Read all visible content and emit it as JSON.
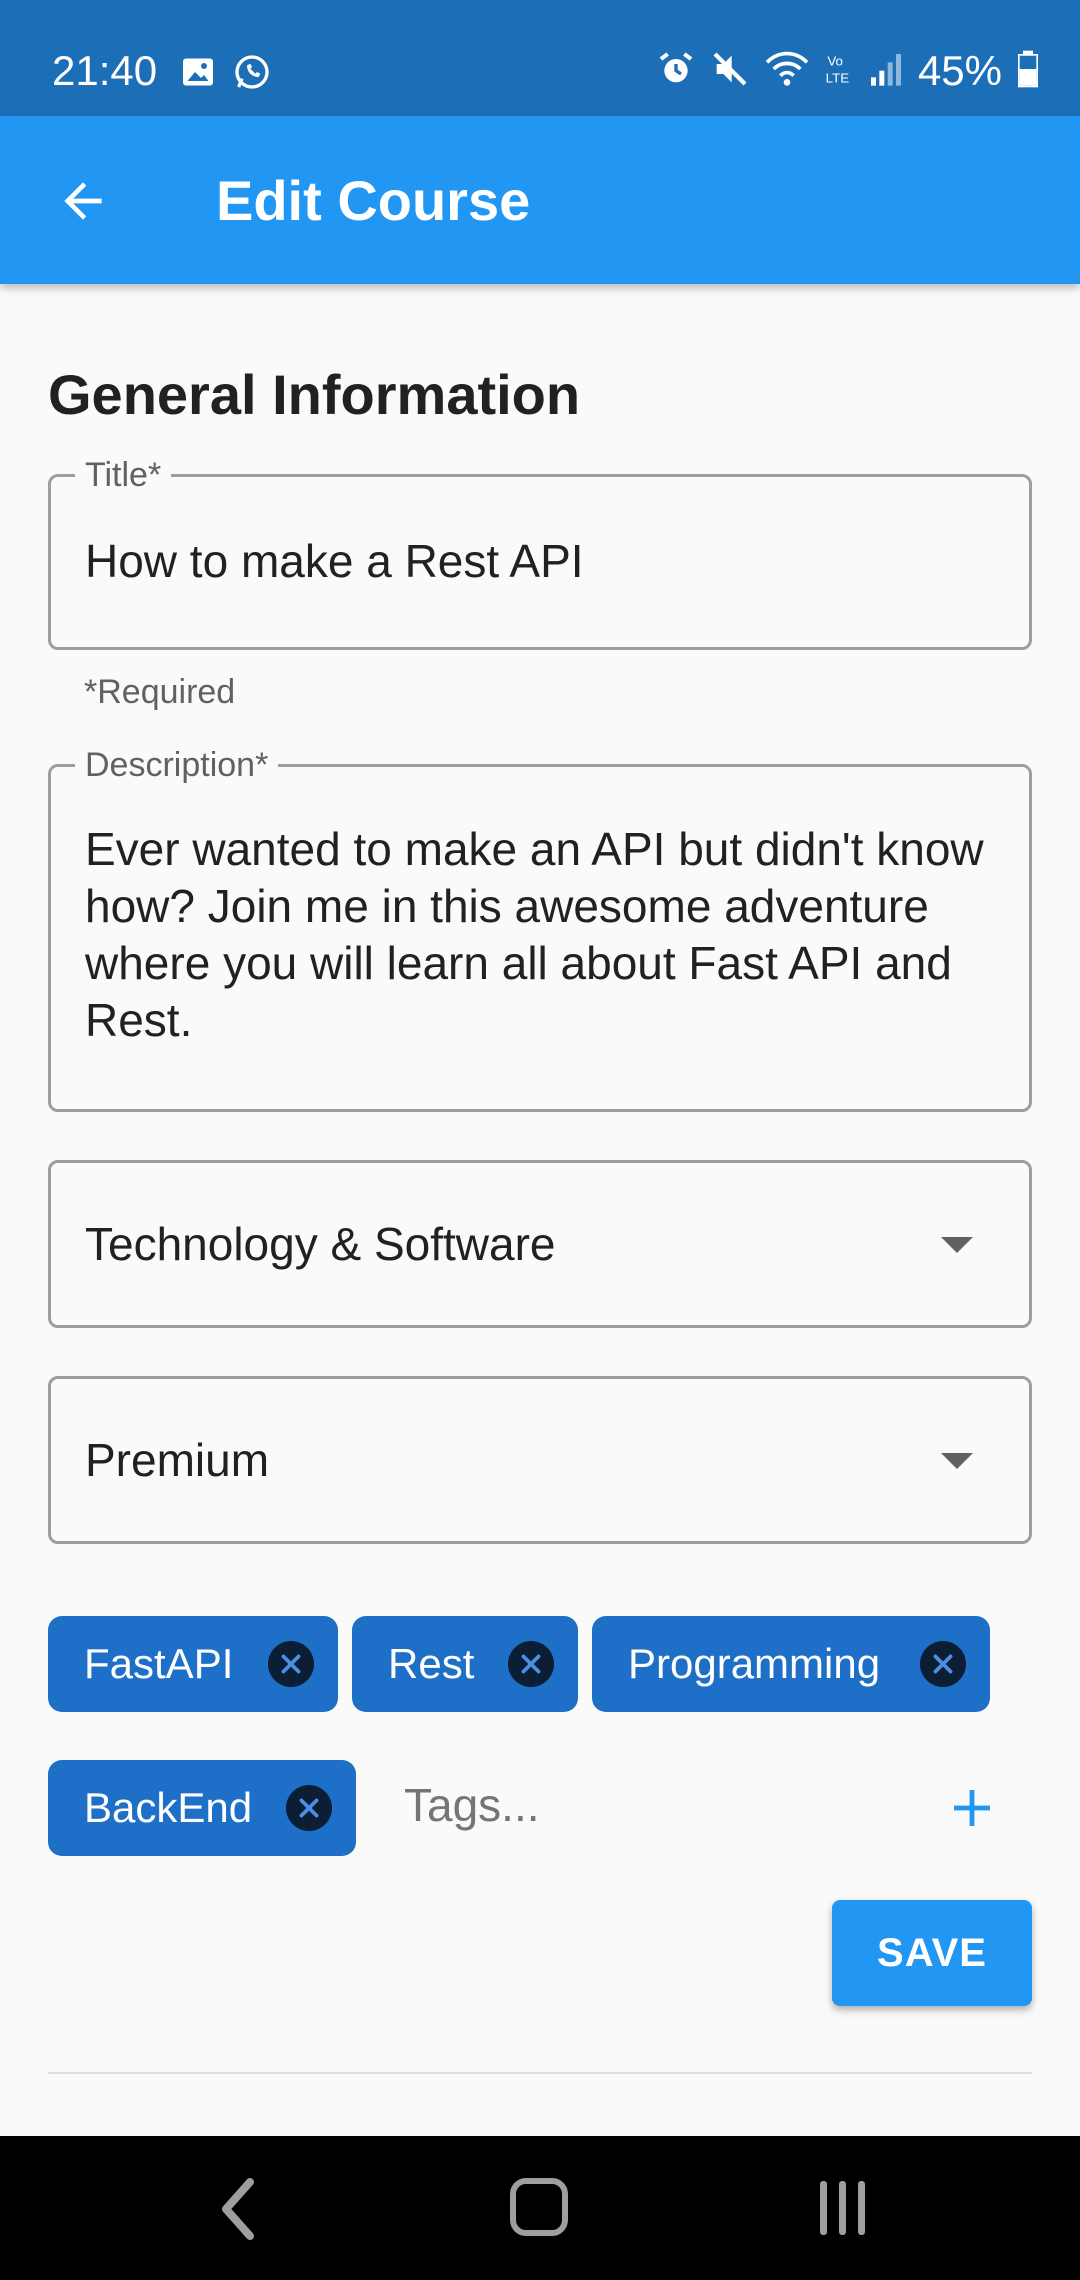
{
  "status_bar": {
    "time": "21:40",
    "battery": "45%",
    "icons": [
      "image-icon",
      "whatsapp-icon",
      "alarm-icon",
      "mute-icon",
      "wifi-icon",
      "volte-icon",
      "signal-icon",
      "battery-icon"
    ]
  },
  "app_bar": {
    "title": "Edit Course",
    "back_icon": "arrow-back-icon"
  },
  "form": {
    "section_title": "General Information",
    "title_field": {
      "label": "Title*",
      "value": "How to make a Rest API",
      "helper": "*Required"
    },
    "description_field": {
      "label": "Description*",
      "value": "Ever wanted to make an API but didn't know how? Join me in this awesome adventure where you will learn all about Fast API and Rest."
    },
    "category_dropdown": {
      "selected": "Technology & Software"
    },
    "pricing_dropdown": {
      "selected": "Premium"
    },
    "tags": [
      {
        "label": "FastAPI"
      },
      {
        "label": "Rest"
      },
      {
        "label": "Programming"
      },
      {
        "label": "BackEnd"
      }
    ],
    "tags_input": {
      "placeholder": "Tags..."
    },
    "save_label": "SAVE"
  },
  "colors": {
    "status_bar": "#1c6fb7",
    "app_bar": "#2196f3",
    "chip": "#1e6fc7",
    "save_button": "#2196f3",
    "field_border": "#9e9e9e"
  }
}
